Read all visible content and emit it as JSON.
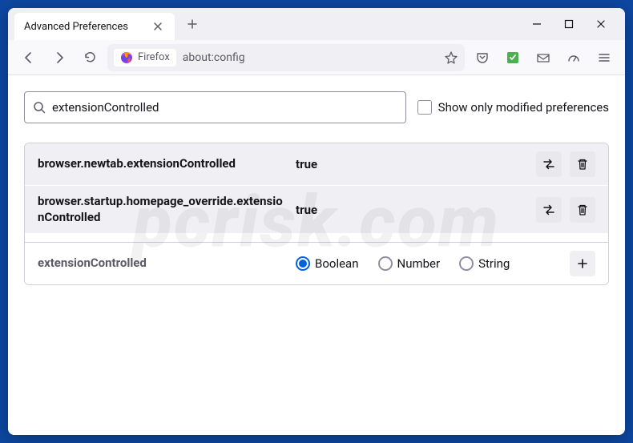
{
  "window": {
    "tab_title": "Advanced Preferences"
  },
  "urlbar": {
    "identity_label": "Firefox",
    "url": "about:config"
  },
  "search": {
    "value": "extensionControlled",
    "checkbox_label": "Show only modified preferences"
  },
  "prefs": [
    {
      "name": "browser.newtab.extensionControlled",
      "value": "true"
    },
    {
      "name": "browser.startup.homepage_override.extensionControlled",
      "value": "true"
    }
  ],
  "new_pref": {
    "name": "extensionControlled",
    "types": [
      "Boolean",
      "Number",
      "String"
    ],
    "selected": "Boolean"
  },
  "watermark": "pcrisk.com"
}
